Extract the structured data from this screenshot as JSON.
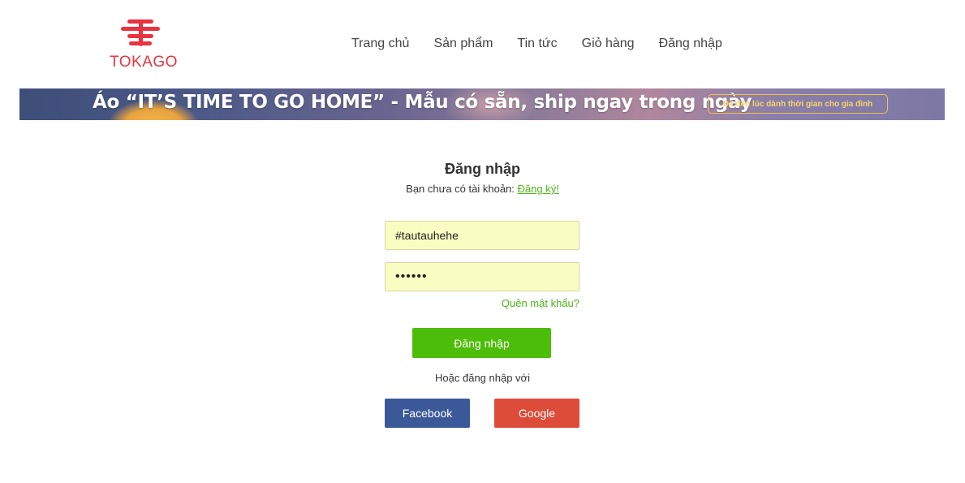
{
  "brand": {
    "name": "TOKAGO",
    "color": "#e8343f"
  },
  "nav": {
    "items": [
      {
        "label": "Trang chủ"
      },
      {
        "label": "Sản phẩm"
      },
      {
        "label": "Tin tức"
      },
      {
        "label": "Giỏ hàng"
      },
      {
        "label": "Đăng nhập"
      }
    ]
  },
  "banner": {
    "headline": "Áo “IT’S TIME TO GO HOME” - Mẫu có sẵn, ship ngay trong ngày",
    "tagline": "Đã đến lúc dành thời gian cho gia đình"
  },
  "login": {
    "title": "Đăng nhập",
    "no_account_text": "Bạn chưa có tài khoản:",
    "register_link": "Đăng ký!",
    "username_value": "#tautauhehe",
    "password_value": "••••••",
    "forgot_password": "Quên mật khẩu?",
    "submit_label": "Đăng nhập",
    "or_text": "Hoặc đăng nhập với",
    "facebook_label": "Facebook",
    "google_label": "Google"
  },
  "colors": {
    "accent_green": "#4cbd08",
    "link_green": "#4cb51a",
    "facebook_blue": "#3b5999",
    "google_red": "#dd4b39",
    "input_bg": "#fafdc1"
  }
}
